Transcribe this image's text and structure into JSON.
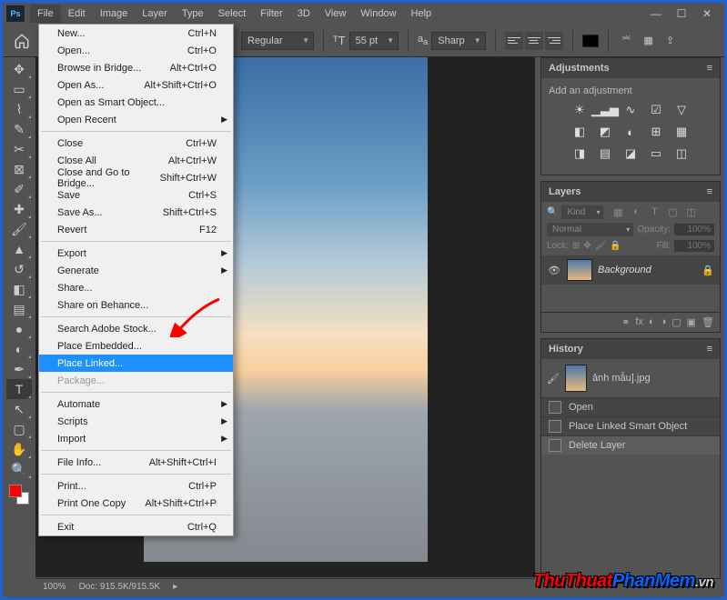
{
  "menubar": [
    "File",
    "Edit",
    "Image",
    "Layer",
    "Type",
    "Select",
    "Filter",
    "3D",
    "View",
    "Window",
    "Help"
  ],
  "active_menu_index": 0,
  "optbar": {
    "weight": "Regular",
    "size": "55 pt",
    "aa": "Sharp"
  },
  "file_menu": [
    {
      "label": "New...",
      "sc": "Ctrl+N"
    },
    {
      "label": "Open...",
      "sc": "Ctrl+O"
    },
    {
      "label": "Browse in Bridge...",
      "sc": "Alt+Ctrl+O"
    },
    {
      "label": "Open As...",
      "sc": "Alt+Shift+Ctrl+O"
    },
    {
      "label": "Open as Smart Object...",
      "sc": ""
    },
    {
      "label": "Open Recent",
      "sc": "",
      "sub": true
    },
    {
      "sep": true
    },
    {
      "label": "Close",
      "sc": "Ctrl+W"
    },
    {
      "label": "Close All",
      "sc": "Alt+Ctrl+W"
    },
    {
      "label": "Close and Go to Bridge...",
      "sc": "Shift+Ctrl+W"
    },
    {
      "label": "Save",
      "sc": "Ctrl+S"
    },
    {
      "label": "Save As...",
      "sc": "Shift+Ctrl+S"
    },
    {
      "label": "Revert",
      "sc": "F12"
    },
    {
      "sep": true
    },
    {
      "label": "Export",
      "sc": "",
      "sub": true
    },
    {
      "label": "Generate",
      "sc": "",
      "sub": true
    },
    {
      "label": "Share...",
      "sc": ""
    },
    {
      "label": "Share on Behance...",
      "sc": ""
    },
    {
      "sep": true
    },
    {
      "label": "Search Adobe Stock...",
      "sc": ""
    },
    {
      "label": "Place Embedded...",
      "sc": ""
    },
    {
      "label": "Place Linked...",
      "sc": "",
      "hl": true
    },
    {
      "label": "Package...",
      "sc": "",
      "dis": true
    },
    {
      "sep": true
    },
    {
      "label": "Automate",
      "sc": "",
      "sub": true
    },
    {
      "label": "Scripts",
      "sc": "",
      "sub": true
    },
    {
      "label": "Import",
      "sc": "",
      "sub": true
    },
    {
      "sep": true
    },
    {
      "label": "File Info...",
      "sc": "Alt+Shift+Ctrl+I"
    },
    {
      "sep": true
    },
    {
      "label": "Print...",
      "sc": "Ctrl+P"
    },
    {
      "label": "Print One Copy",
      "sc": "Alt+Shift+Ctrl+P"
    },
    {
      "sep": true
    },
    {
      "label": "Exit",
      "sc": "Ctrl+Q"
    }
  ],
  "tools": [
    {
      "name": "move-tool",
      "glyph": "✥"
    },
    {
      "name": "marquee-tool",
      "glyph": "▭"
    },
    {
      "name": "lasso-tool",
      "glyph": "⌇"
    },
    {
      "name": "quick-select-tool",
      "glyph": "✎"
    },
    {
      "name": "crop-tool",
      "glyph": "✂"
    },
    {
      "name": "frame-tool",
      "glyph": "⊠"
    },
    {
      "name": "eyedropper-tool",
      "glyph": "✐"
    },
    {
      "name": "healing-tool",
      "glyph": "✚"
    },
    {
      "name": "brush-tool",
      "glyph": "🖌"
    },
    {
      "name": "stamp-tool",
      "glyph": "▲"
    },
    {
      "name": "history-brush-tool",
      "glyph": "↺"
    },
    {
      "name": "eraser-tool",
      "glyph": "◧"
    },
    {
      "name": "gradient-tool",
      "glyph": "▤"
    },
    {
      "name": "blur-tool",
      "glyph": "●"
    },
    {
      "name": "dodge-tool",
      "glyph": "◐"
    },
    {
      "name": "pen-tool",
      "glyph": "✒"
    },
    {
      "name": "type-tool",
      "glyph": "T",
      "sel": true
    },
    {
      "name": "path-tool",
      "glyph": "↖"
    },
    {
      "name": "rectangle-tool",
      "glyph": "▢"
    },
    {
      "name": "hand-tool",
      "glyph": "✋"
    },
    {
      "name": "zoom-tool",
      "glyph": "🔍"
    }
  ],
  "panels": {
    "adjustments": {
      "title": "Adjustments",
      "hint": "Add an adjustment"
    },
    "layers": {
      "title": "Layers",
      "kind_label": "Kind",
      "blend": "Normal",
      "opacity_label": "Opacity:",
      "opacity": "100%",
      "lock_label": "Lock:",
      "fill_label": "Fill:",
      "fill": "100%",
      "layer": "Background"
    },
    "history": {
      "title": "History",
      "doc": "ảnh mẫu].jpg",
      "items": [
        "Open",
        "Place Linked Smart Object",
        "Delete Layer"
      ],
      "selected_index": 2
    }
  },
  "status": {
    "zoom": "100%",
    "docsize": "Doc: 915.5K/915.5K"
  },
  "watermark": {
    "a": "ThuThuat",
    "b": "PhanMem",
    "c": ".vn"
  }
}
